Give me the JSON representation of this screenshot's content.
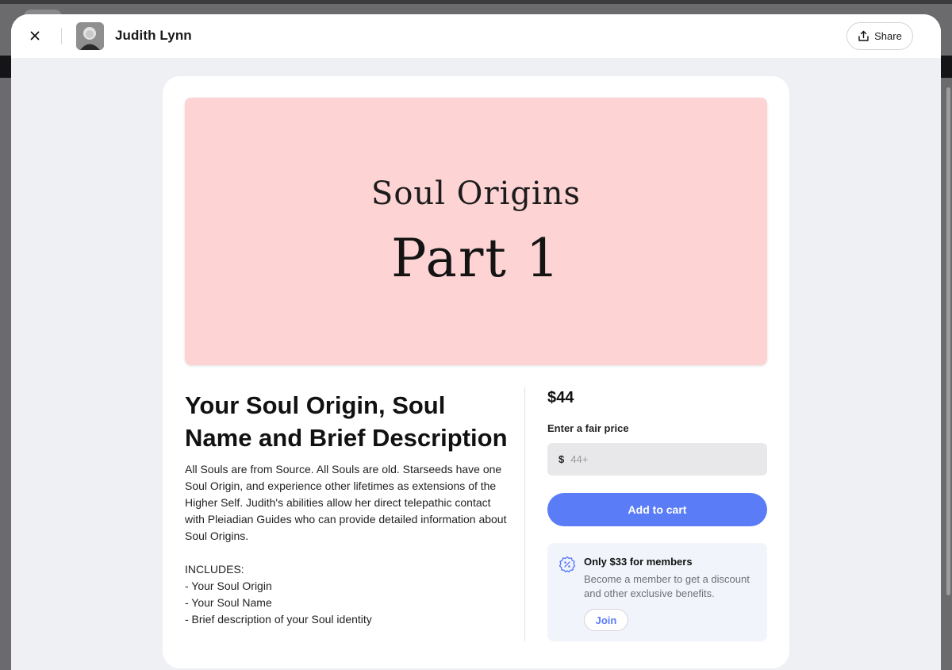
{
  "header": {
    "author_name": "Judith Lynn",
    "share_label": "Share"
  },
  "hero": {
    "line1": "Soul Origins",
    "line2": "Part 1",
    "background": "#fdd3d3"
  },
  "product": {
    "title": "Your Soul Origin, Soul Name and Brief Description",
    "description": "All Souls are from Source. All Souls are old. Starseeds have one Soul Origin, and experience other lifetimes as extensions of the Higher Self. Judith's abilities allow her direct telepathic contact with Pleiadian Guides who can provide detailed information about Soul Origins.\n\nINCLUDES:\n- Your Soul Origin\n- Your Soul Name\n- Brief description of your Soul identity"
  },
  "purchase": {
    "price": "$44",
    "fair_price_label": "Enter a fair price",
    "currency_symbol": "$",
    "price_placeholder": "44+",
    "add_to_cart_label": "Add to cart",
    "accent_color": "#5b7cf7"
  },
  "membership": {
    "title": "Only $33 for members",
    "text": "Become a member to get a discount and other exclusive benefits.",
    "join_label": "Join",
    "icon": "discount-badge-icon"
  },
  "icons": {
    "close": "close-icon",
    "share": "share-icon"
  }
}
